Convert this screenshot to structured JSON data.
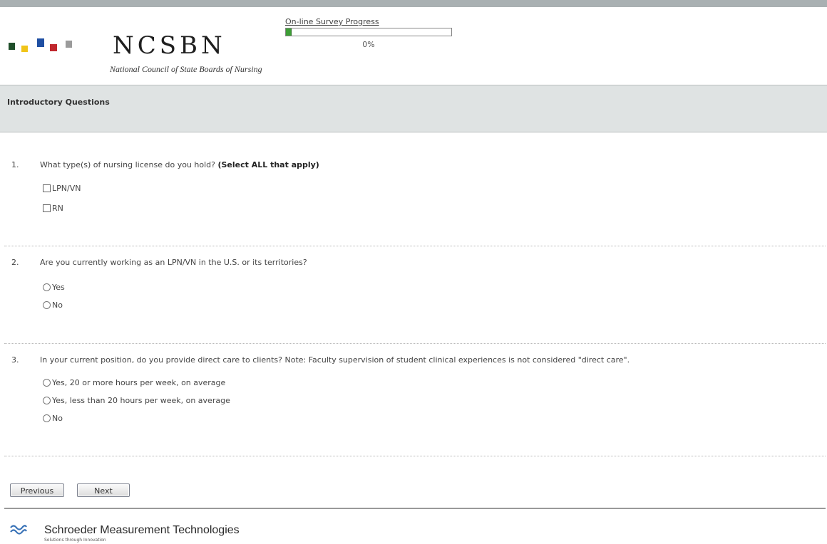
{
  "header": {
    "logo_text": "NCSBN",
    "logo_tagline": "National Council of State Boards of Nursing",
    "logo_squares": [
      "#1f4e2a",
      "#f0c419",
      "#1f4fa3",
      "#c0272d",
      "#9b9b9b"
    ]
  },
  "progress": {
    "label": "On-line Survey Progress",
    "percent_text": "0%",
    "fraction": 0.03
  },
  "section": {
    "title": "Introductory Questions"
  },
  "questions": [
    {
      "number": "1.",
      "text": "What type(s) of nursing license do you hold?",
      "note": "(Select ALL that apply)",
      "input_type": "checkbox",
      "options": [
        "LPN/VN",
        "RN"
      ]
    },
    {
      "number": "2.",
      "text": "Are you currently working as an LPN/VN in the U.S. or its territories?",
      "input_type": "radio",
      "options": [
        "Yes",
        "No"
      ]
    },
    {
      "number": "3.",
      "text": "In your current position, do you provide direct care to clients? Note: Faculty supervision of student clinical experiences is not considered \"direct care\".",
      "input_type": "radio",
      "options": [
        "Yes, 20 or more hours per week, on average",
        "Yes, less than 20 hours per week, on average",
        "No"
      ]
    }
  ],
  "buttons": {
    "previous": "Previous",
    "next": "Next"
  },
  "footer": {
    "company": "Schroeder Measurement Technologies",
    "tagline": "Solutions through Innovation"
  }
}
